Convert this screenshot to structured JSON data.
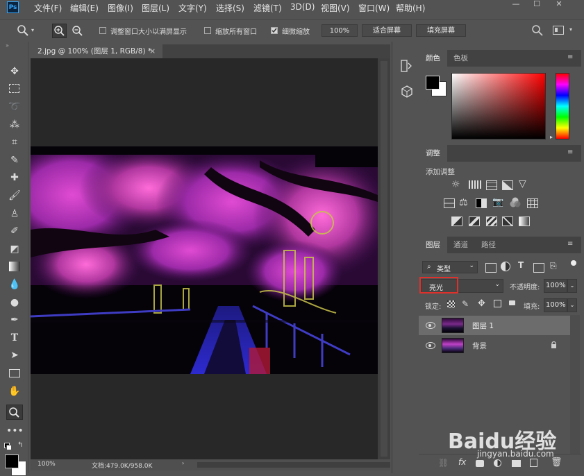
{
  "app": {
    "logo": "Ps"
  },
  "menubar": {
    "items": [
      "文件(F)",
      "编辑(E)",
      "图像(I)",
      "图层(L)",
      "文字(Y)",
      "选择(S)",
      "滤镜(T)",
      "3D(D)",
      "视图(V)",
      "窗口(W)",
      "帮助(H)"
    ],
    "window_controls": {
      "minimize": "—",
      "maximize": "☐",
      "close": "✕"
    }
  },
  "options_bar": {
    "resize_window_label": "调整窗口大小以满屏显示",
    "resize_window_checked": false,
    "zoom_all_windows_label": "缩放所有窗口",
    "zoom_all_windows_checked": false,
    "scrubby_zoom_label": "细微缩放",
    "scrubby_zoom_checked": true,
    "zoom_value": "100%",
    "fit_screen_label": "适合屏幕",
    "fill_screen_label": "填充屏幕"
  },
  "document": {
    "tab_title": "2.jpg @ 100% (图层 1, RGB/8) *",
    "tab_close": "×",
    "status_zoom": "100%",
    "status_doc": "文档:479.0K/958.0K"
  },
  "color_panel": {
    "tabs": [
      "颜色",
      "色板"
    ],
    "active_tab": 0,
    "foreground": "#000000",
    "background": "#ffffff",
    "hue_color": "#ff0000"
  },
  "adjustments_panel": {
    "tab": "调整",
    "add_label": "添加调整"
  },
  "layers_panel": {
    "tabs": [
      "图层",
      "通道",
      "路径"
    ],
    "active_tab": 0,
    "filter_kind": "类型",
    "blend_mode": "亮光",
    "opacity_label": "不透明度:",
    "opacity_value": "100%",
    "lock_label": "锁定:",
    "fill_label": "填充:",
    "fill_value": "100%",
    "layers": [
      {
        "name": "图层 1",
        "selected": true,
        "locked": false
      },
      {
        "name": "背景",
        "selected": false,
        "locked": true
      }
    ]
  },
  "watermark": {
    "brand": "Baidu经验",
    "url": "jingyan.baidu.com"
  },
  "colors": {
    "ui_bg": "#535353",
    "canvas_bg": "#282828",
    "highlight_box": "#e0302b",
    "selected_layer": "#6c6c6c"
  }
}
